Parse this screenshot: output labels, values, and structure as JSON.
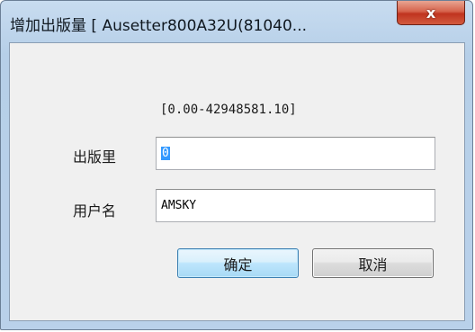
{
  "window": {
    "title": "增加出版量 [ Ausetter800A32U(81040...",
    "close_glyph": "x"
  },
  "form": {
    "range": "[0.00-42948581.10]",
    "amount_label": "出版里",
    "amount_value": "0",
    "user_label": "用户名",
    "user_value": "AMSKY"
  },
  "buttons": {
    "ok_label": "确定",
    "cancel_label": "取消"
  }
}
